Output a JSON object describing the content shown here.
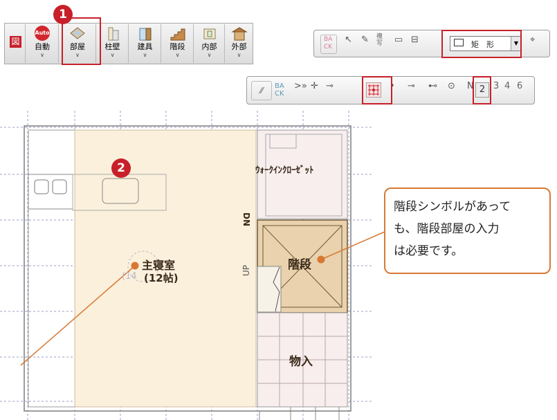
{
  "main_toolbar": {
    "items": [
      {
        "label": "自動",
        "icon": "auto-icon",
        "badge": "Auto"
      },
      {
        "label": "部屋",
        "icon": "room-icon"
      },
      {
        "label": "柱壁",
        "icon": "column-wall-icon"
      },
      {
        "label": "建具",
        "icon": "fitting-icon"
      },
      {
        "label": "階段",
        "icon": "stairs-icon"
      },
      {
        "label": "内部",
        "icon": "interior-icon"
      },
      {
        "label": "外部",
        "icon": "exterior-icon"
      }
    ],
    "left_label": "図",
    "dropdown_arrow": "∨"
  },
  "steps": {
    "step1": "1",
    "step2": "2"
  },
  "input_toolbar": {
    "back_label": "BA\nCK",
    "copy_label": "複写",
    "shape_select_value": "矩　形"
  },
  "snap_toolbar": {
    "back_label": "BA CK",
    "numbers": [
      "2",
      "3",
      "4",
      "6"
    ],
    "n_label": "N"
  },
  "plan": {
    "rooms": {
      "master_bedroom": "主寝室",
      "master_bedroom_size": "(12帖)",
      "walk_in_closet": "ｳｫｰｸｲﾝｸﾛｰｾﾞｯﾄ",
      "stairs": "階段",
      "storage": "物入",
      "dn": "DN",
      "up": "UP",
      "ghost_size": "(14"
    }
  },
  "callout": {
    "text_line1": "階段シンボルがあって",
    "text_line2": "も、階段部屋の入力",
    "text_line3": "は必要です。"
  },
  "colors": {
    "accent_red": "#c7202a",
    "callout_orange": "#d77934",
    "room_fill": "#fbf0dc",
    "stairs_fill": "#e9d2ad"
  }
}
